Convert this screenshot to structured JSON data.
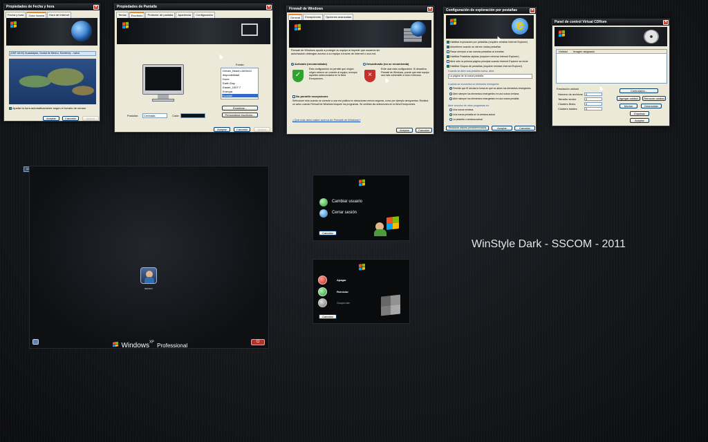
{
  "caption": "WinStyle Dark - SSCOM - 2011",
  "datetime": {
    "title": "Propiedades de Fecha y hora",
    "tabs": [
      "Fecha y hora",
      "Zona horaria",
      "Hora de Internet"
    ],
    "zone": "(GMT-06:00) Guadalajara, Ciudad de México, Monterrey - nuevo",
    "dst_label": "Ajustar la hora automáticamente según el horario de verano",
    "ok": "Aceptar",
    "cancel": "Cancelar",
    "apply": "Aplicar"
  },
  "display": {
    "title": "Propiedades de Pantalla",
    "tabs": [
      "Temas",
      "Escritorio",
      "Protector de pantalla",
      "Apariencia",
      "Configuración"
    ],
    "bg_label": "Fondo:",
    "bg_items": [
      "Dream_Beach-1600x12",
      "disponibilidad",
      "Dune",
      "Earth Day",
      "Easter_1007.7",
      "Energía",
      "Escalabi"
    ],
    "browse": "Examinar...",
    "customize": "Personalizar escritorio...",
    "position_label": "Posición:",
    "position_value": "Centrada",
    "color_label": "Color:",
    "ok": "Aceptar",
    "cancel": "Cancelar",
    "apply": "Aplicar"
  },
  "firewall": {
    "title": "Firewall de Windows",
    "tabs": [
      "General",
      "Excepciones",
      "Opciones avanzadas"
    ],
    "intro": "Firewall de Windows ayuda a proteger su equipo al impedir que usuarios sin autorización obtengan acceso a su equipo a través de Internet o una red.",
    "on_label": "Activado (recomendado)",
    "on_desc": "Esta configuración no permite que ningún origen externo se conecte al equipo, excepto aquellos seleccionados en la ficha Excepciones.",
    "off_label": "Desactivado (no se recomienda)",
    "off_desc": "Evite usar esta configuración. Si desactiva Firewall de Windows, puede que este equipo sea más vulnerable a virus e intrusos.",
    "noexc_label": "No permitir excepciones",
    "noexc_desc": "Seleccione esto cuando se conecte a una red pública en ubicaciones menos seguras, como por ejemplo aeropuertos. Recibirá un aviso cuando Firewall de Windows bloquee los programas. Se omitirán las selecciones en la ficha Excepciones.",
    "link": "¿Qué más debo saber acerca de Firewall de Windows?",
    "ok": "Aceptar",
    "cancel": "Cancelar"
  },
  "tabbed": {
    "title": "Configuración de exploración por pestañas",
    "options": [
      "Habilitar exploración por pestañas (requiere reiniciar Internet Explorer)",
      "Advertirme cuando se cierren varias pestañas",
      "Pasar siempre a las nuevas pestañas al crearlas",
      "Habilitar Pestañas rápidas (requiere reiniciar Internet Explorer)",
      "Abrir sólo la primera página principal cuando Internet Explorer se inicie",
      "Habilitar Grupos de pestañas (requiere reiniciar Internet Explorer)"
    ],
    "newtab_label": "Cuando se abre una pestaña nueva, abrir:",
    "newtab_value": "La página de la nueva pestaña",
    "popup_label": "Cuando se encuentra un elemento emergente:",
    "popup_options": [
      "Permitir que IE decida la forma en que se abren los elementos emergentes",
      "Abrir siempre los elementos emergentes en una nueva ventana",
      "Abrir siempre los elementos emergentes en una nueva pestaña"
    ],
    "links_label": "Abrir vínculos de otros programas en:",
    "links_options": [
      "Una nueva ventana",
      "Una nueva pestaña en la ventana actual",
      "La pestaña o ventana actual"
    ],
    "restore": "Restaurar valores predeterminados",
    "ok": "Aceptar",
    "cancel": "Cancelar"
  },
  "cdrom": {
    "title": "Panel de control Virtual CDRom",
    "col_unit": "Unidad",
    "col_image": "Imagen asignada",
    "drive_label": "Emulación unidad",
    "stats": [
      "Número de archivos",
      "Tamaño sector",
      "Clusters libres",
      "Clusters totales"
    ],
    "stat_values": [
      "0",
      "0",
      "0",
      "0"
    ],
    "buttons": [
      "Controlador...",
      "Agregar unidad",
      "Remover unidad",
      "Montar",
      "Desmontar",
      "Expulsar",
      "Aceptar"
    ]
  },
  "welcome": {
    "badge": "XX",
    "user": "sscom",
    "brand": "Windows",
    "brand_sup": "XP",
    "edition": "Professional"
  },
  "switchuser": {
    "switch": "Cambiar usuario",
    "logoff": "Cerrar sesión",
    "cancel": "Cancelar"
  },
  "shutdown": {
    "off": "Apagar",
    "restart": "Reiniciar",
    "standby": "Suspender",
    "cancel": "Cancelar"
  },
  "colors": {
    "accent_green": "#21a121",
    "accent_red": "#c8402e",
    "xp_blue": "#003c74"
  }
}
